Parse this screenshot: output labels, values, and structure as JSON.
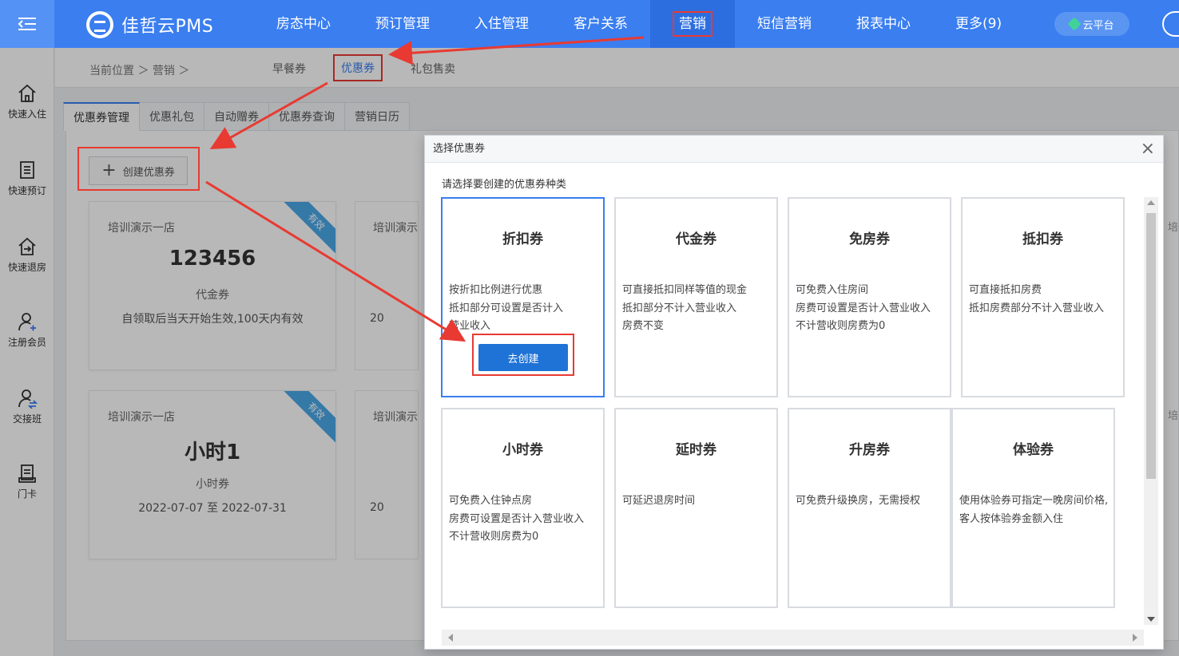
{
  "app": {
    "brand": "佳哲云PMS",
    "nav": [
      "房态中心",
      "预订管理",
      "入住管理",
      "客户关系",
      "营销",
      "短信营销",
      "报表中心",
      "更多(9)"
    ],
    "nav_active_index": 4,
    "cloud_label": "云平台"
  },
  "sidebar": {
    "items": [
      {
        "label": "快速入住",
        "icon": "home-icon"
      },
      {
        "label": "快速预订",
        "icon": "document-icon"
      },
      {
        "label": "快速退房",
        "icon": "checkout-icon"
      },
      {
        "label": "注册会员",
        "icon": "add-user-icon"
      },
      {
        "label": "交接班",
        "icon": "shift-icon"
      },
      {
        "label": "门卡",
        "icon": "card-icon"
      }
    ]
  },
  "breadcrumb": {
    "text": "当前位置 ＞ 营销 ＞",
    "subtabs": [
      "早餐券",
      "优惠券",
      "礼包售卖"
    ],
    "active_subtab_index": 1
  },
  "tabs": [
    "优惠券管理",
    "优惠礼包",
    "自动赠券",
    "优惠券查询",
    "营销日历"
  ],
  "active_tab_index": 0,
  "create_button": "创建优惠券",
  "coupon_cards": [
    {
      "store": "培训演示一店",
      "name": "123456",
      "type": "代金券",
      "desc": "自领取后当天开始生效,100天内有效",
      "badge": "有效"
    },
    {
      "store": "培训演示一店",
      "name": "小时1",
      "type": "小时券",
      "desc": "2022-07-07 至 2022-07-31",
      "badge": "有效"
    }
  ],
  "partial_cards": [
    {
      "store": "培训演示一",
      "year": "20"
    },
    {
      "store": "培训演示一",
      "year": "20"
    }
  ],
  "right_peek": [
    "培",
    "培"
  ],
  "modal": {
    "title": "选择优惠券",
    "close": "×",
    "tip": "请选择要创建的优惠券种类",
    "types": [
      {
        "title": "折扣券",
        "lines": [
          "按折扣比例进行优惠",
          "抵扣部分可设置是否计入",
          "营业收入"
        ],
        "selected": true,
        "button": "去创建"
      },
      {
        "title": "代金券",
        "lines": [
          "可直接抵扣同样等值的现金",
          "抵扣部分不计入营业收入",
          "房费不变"
        ]
      },
      {
        "title": "免房券",
        "lines": [
          "可免费入住房间",
          "房费可设置是否计入营业收入",
          "不计营收则房费为0"
        ]
      },
      {
        "title": "抵扣券",
        "lines": [
          "可直接抵扣房费",
          "抵扣房费部分不计入营业收入"
        ]
      },
      {
        "title": "小时券",
        "lines": [
          "可免费入住钟点房",
          "房费可设置是否计入营业收入",
          "不计营收则房费为0"
        ]
      },
      {
        "title": "延时券",
        "lines": [
          "可延迟退房时间"
        ]
      },
      {
        "title": "升房券",
        "lines": [
          "可免费升级换房，无需授权"
        ]
      },
      {
        "title": "体验券",
        "lines": [
          "使用体验券可指定一晚房间价格,",
          "客人按体验券金额入住"
        ]
      }
    ]
  },
  "colors": {
    "primary": "#3a7ef0",
    "button": "#1f73d6",
    "highlight": "#e83a32",
    "ribbon": "#4aa8e8"
  }
}
